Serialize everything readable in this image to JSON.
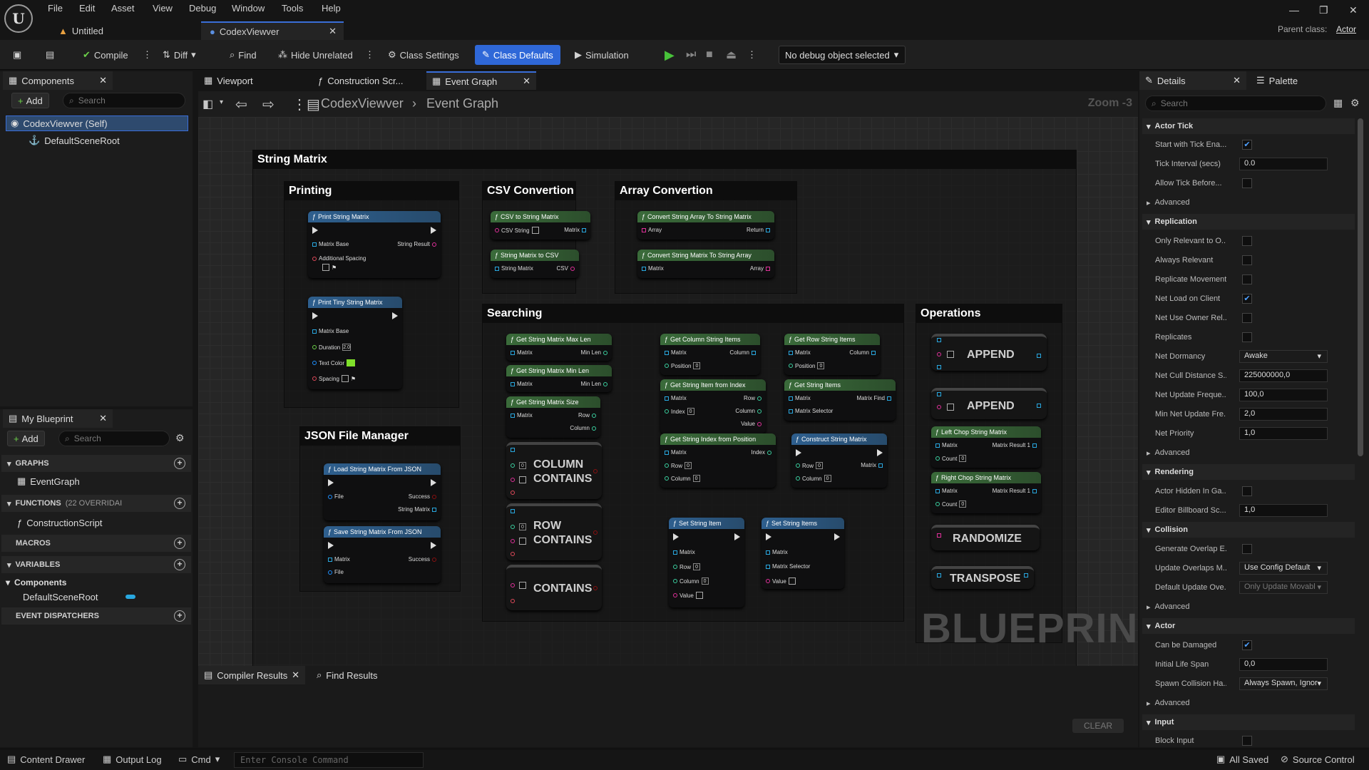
{
  "app": {
    "logo": "U",
    "parent_class_label": "Parent class:",
    "parent_class_value": "Actor"
  },
  "menu": [
    "File",
    "Edit",
    "Asset",
    "View",
    "Debug",
    "Window",
    "Tools",
    "Help"
  ],
  "doc_tabs": [
    {
      "label": "Untitled"
    },
    {
      "label": "CodexViewver"
    }
  ],
  "toolbar": {
    "compile": "Compile",
    "diff": "Diff",
    "find": "Find",
    "hide_unrelated": "Hide Unrelated",
    "class_settings": "Class Settings",
    "class_defaults": "Class Defaults",
    "simulation": "Simulation",
    "debug_object": "No debug object selected"
  },
  "components": {
    "tab": "Components",
    "add": "Add",
    "search_placeholder": "Search",
    "items": [
      "CodexViewver (Self)",
      "DefaultSceneRoot"
    ]
  },
  "my_blueprint": {
    "tab": "My Blueprint",
    "add": "Add",
    "search_placeholder": "Search",
    "graphs": "GRAPHS",
    "event_graph": "EventGraph",
    "functions": "FUNCTIONS",
    "functions_count": "(22 OVERRIDAI",
    "construction_script": "ConstructionScript",
    "macros": "MACROS",
    "variables": "VARIABLES",
    "components": "Components",
    "default_scene_root": "DefaultSceneRoot",
    "event_dispatchers": "EVENT DISPATCHERS"
  },
  "graph_tabs": [
    "Viewport",
    "Construction Scr...",
    "Event Graph"
  ],
  "breadcrumb": {
    "root": "CodexViewver",
    "child": "Event Graph",
    "zoom": "Zoom -3"
  },
  "comments": {
    "main": "String Matrix",
    "printing": "Printing",
    "csv": "CSV Convertion",
    "array": "Array Convertion",
    "searching": "Searching",
    "operations": "Operations",
    "json": "JSON File Manager"
  },
  "nodes": {
    "print_matrix": {
      "title": "Print String Matrix",
      "matrix_base": "Matrix Base",
      "string_result": "String Result",
      "additional_spacing": "Additional Spacing"
    },
    "print_tiny": {
      "title": "Print Tiny String Matrix",
      "matrix_base": "Matrix Base",
      "duration": "Duration",
      "duration_val": "2.0",
      "text_color": "Text Color",
      "spacing": "Spacing"
    },
    "csv_to": {
      "title": "CSV to String Matrix",
      "csv_string": "CSV String",
      "matrix": "Matrix"
    },
    "to_csv": {
      "title": "String Matrix to CSV",
      "string_matrix": "String Matrix",
      "csv": "CSV"
    },
    "arr_to": {
      "title": "Convert String Array To String Matrix",
      "array": "Array",
      "return": "Return"
    },
    "to_arr": {
      "title": "Convert String Matrix To String Array",
      "matrix": "Matrix",
      "array": "Array"
    },
    "max_len": {
      "title": "Get String Matrix Max Len",
      "matrix": "Matrix",
      "min_len": "Min Len"
    },
    "min_len": {
      "title": "Get String Matrix Min Len",
      "matrix": "Matrix",
      "min_len": "Min Len"
    },
    "size": {
      "title": "Get String Matrix Size",
      "matrix": "Matrix",
      "row": "Row",
      "column": "Column"
    },
    "col_items": {
      "title": "Get Column String Items",
      "matrix": "Matrix",
      "column": "Column",
      "position": "Position",
      "pos_val": "0"
    },
    "row_items": {
      "title": "Get Row String Items",
      "matrix": "Matrix",
      "column": "Column",
      "position": "Position",
      "pos_val": "0"
    },
    "item_from_index": {
      "title": "Get String Item from Index",
      "matrix": "Matrix",
      "row": "Row",
      "index": "Index",
      "index_val": "0",
      "column": "Column",
      "value": "Value"
    },
    "get_items": {
      "title": "Get String Items",
      "matrix": "Matrix",
      "matrix_find": "Matrix Find",
      "matrix_selector": "Matrix Selector"
    },
    "index_from_pos": {
      "title": "Get String Index from Position",
      "matrix": "Matrix",
      "index": "Index",
      "row": "Row",
      "row_val": "0",
      "column": "Column",
      "col_val": "0"
    },
    "construct": {
      "title": "Construct String Matrix",
      "row": "Row",
      "row_val": "0",
      "matrix": "Matrix",
      "column": "Column",
      "col_val": "0"
    },
    "set_item": {
      "title": "Set String Item",
      "matrix": "Matrix",
      "row": "Row",
      "row_val": "0",
      "column": "Column",
      "col_val": "0",
      "value": "Value"
    },
    "set_items": {
      "title": "Set String Items",
      "matrix": "Matrix",
      "matrix_selector": "Matrix Selector",
      "value": "Value"
    },
    "load_json": {
      "title": "Load String Matrix From JSON",
      "file": "File",
      "success": "Success",
      "string_matrix": "String Matrix"
    },
    "save_json": {
      "title": "Save String Matrix From JSON",
      "matrix": "Matrix",
      "success": "Success",
      "file": "File"
    },
    "column_contains": {
      "line1": "COLUMN",
      "line2": "CONTAINS",
      "num": "0"
    },
    "row_contains": {
      "line1": "ROW",
      "line2": "CONTAINS",
      "num": "0"
    },
    "contains": {
      "line1": "CONTAINS"
    },
    "append1": {
      "label": "APPEND"
    },
    "append2": {
      "label": "APPEND"
    },
    "left_chop": {
      "title": "Left Chop String Matrix",
      "matrix": "Matrix",
      "result": "Matrix Result 1",
      "count": "Count",
      "count_val": "0"
    },
    "right_chop": {
      "title": "Right Chop String Matrix",
      "matrix": "Matrix",
      "result": "Matrix Result 1",
      "count": "Count",
      "count_val": "0"
    },
    "randomize": {
      "label": "RANDOMIZE"
    },
    "transpose": {
      "label": "TRANSPOSE"
    }
  },
  "watermark": "BLUEPRINT",
  "bottom_tabs": {
    "compiler_results": "Compiler Results",
    "find_results": "Find Results",
    "clear": "CLEAR"
  },
  "details": {
    "tab": "Details",
    "palette": "Palette",
    "search_placeholder": "Search",
    "sections": {
      "actor_tick": "Actor Tick",
      "replication": "Replication",
      "rendering": "Rendering",
      "collision": "Collision",
      "actor": "Actor",
      "input": "Input",
      "advanced": "Advanced"
    },
    "rows": {
      "start_tick": "Start with Tick Ena...",
      "tick_interval": "Tick Interval (secs)",
      "tick_interval_val": "0.0",
      "allow_tick": "Allow Tick Before...",
      "only_relevant": "Only Relevant to O...",
      "always_relevant": "Always Relevant",
      "replicate_movement": "Replicate Movement",
      "net_load": "Net Load on Client",
      "net_use_owner": "Net Use Owner Rel...",
      "replicates": "Replicates",
      "net_dormancy": "Net Dormancy",
      "net_dormancy_val": "Awake",
      "net_cull": "Net Cull Distance S...",
      "net_cull_val": "225000000,0",
      "net_update": "Net Update Freque...",
      "net_update_val": "100,0",
      "min_net": "Min Net Update Fre...",
      "min_net_val": "2,0",
      "net_priority": "Net Priority",
      "net_priority_val": "1,0",
      "actor_hidden": "Actor Hidden In Ga...",
      "editor_billboard": "Editor Billboard Sc...",
      "editor_billboard_val": "1,0",
      "gen_overlap": "Generate Overlap E...",
      "update_overlaps": "Update Overlaps M...",
      "update_overlaps_val": "Use Config Default",
      "default_update": "Default Update Ove...",
      "default_update_val": "Only Update Movabl",
      "can_be_damaged": "Can be Damaged",
      "initial_life": "Initial Life Span",
      "initial_life_val": "0,0",
      "spawn_collision": "Spawn Collision Ha...",
      "spawn_collision_val": "Always Spawn, Ignor",
      "block_input": "Block Input"
    }
  },
  "status": {
    "content_drawer": "Content Drawer",
    "output_log": "Output Log",
    "cmd": "Cmd",
    "console_placeholder": "Enter Console Command",
    "all_saved": "All Saved",
    "source_control": "Source Control"
  },
  "colors": {
    "accent": "#2f68d8",
    "text_color_swatch": "#7fe02a",
    "exec_green": "#48c23a"
  }
}
